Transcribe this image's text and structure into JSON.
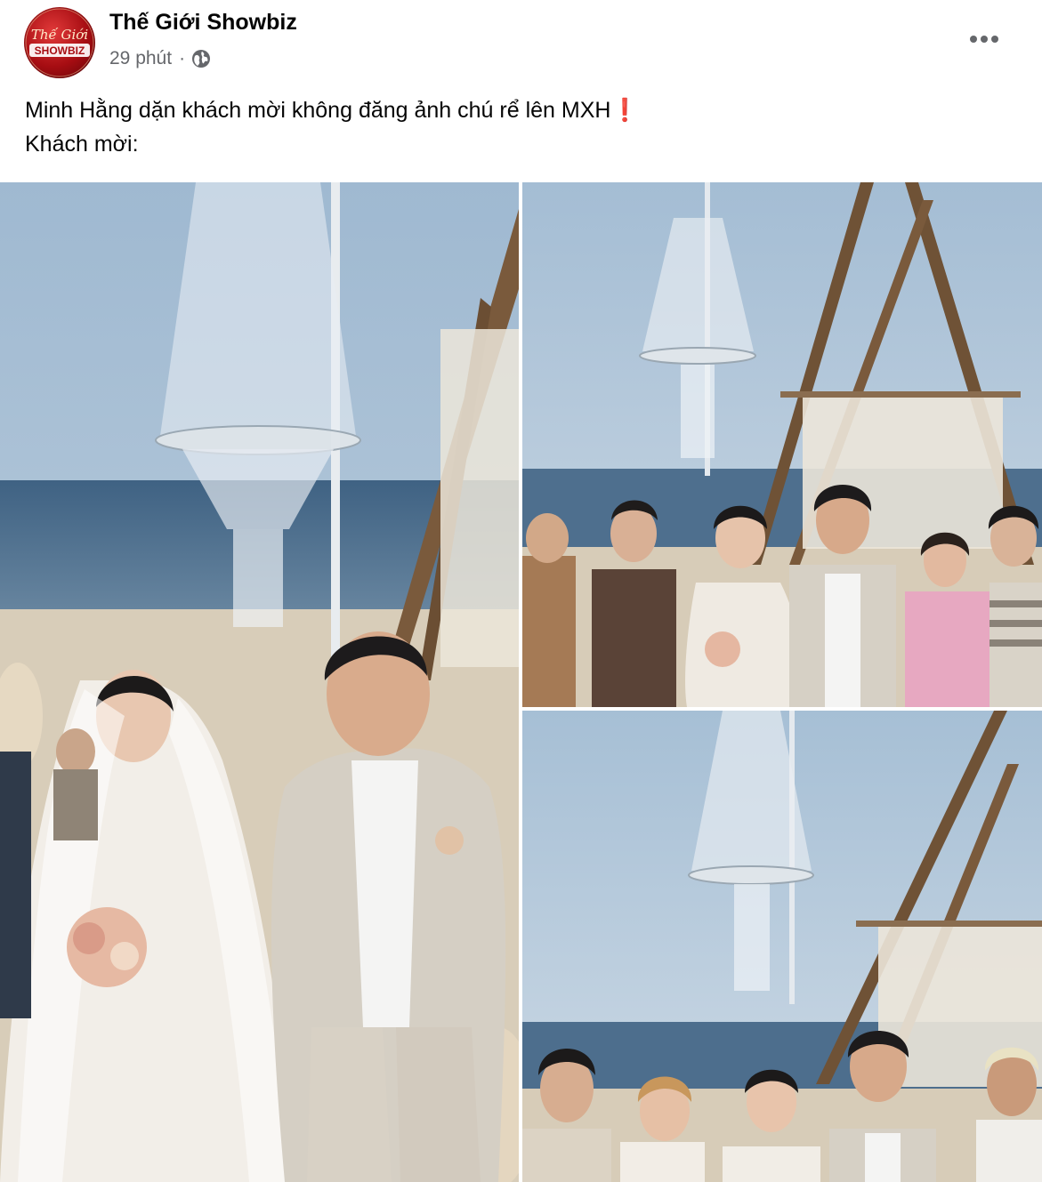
{
  "post": {
    "page_name": "Thế Giới Showbiz",
    "avatar_text_top": "Thế Giới",
    "avatar_text_bottom": "SHOWBIZ",
    "time": "29 phút",
    "separator": "·",
    "privacy_icon": "globe-icon",
    "more_icon": "more-horizontal-icon"
  },
  "caption": {
    "line1": "Minh Hằng dặn khách mời không đăng ảnh chú rể lên MXH",
    "line1_emoji": "❗",
    "line2": "Khách mời:"
  },
  "photos": [
    {
      "name": "photo-bride-groom"
    },
    {
      "name": "photo-guests-group-1"
    },
    {
      "name": "photo-guests-group-2"
    }
  ],
  "colors": {
    "text_primary": "#050505",
    "text_secondary": "#65676b",
    "avatar_red": "#a60d12",
    "sky": "#a9c1d6",
    "sea": "#4f6f8c",
    "sand": "#d6c9b4"
  }
}
